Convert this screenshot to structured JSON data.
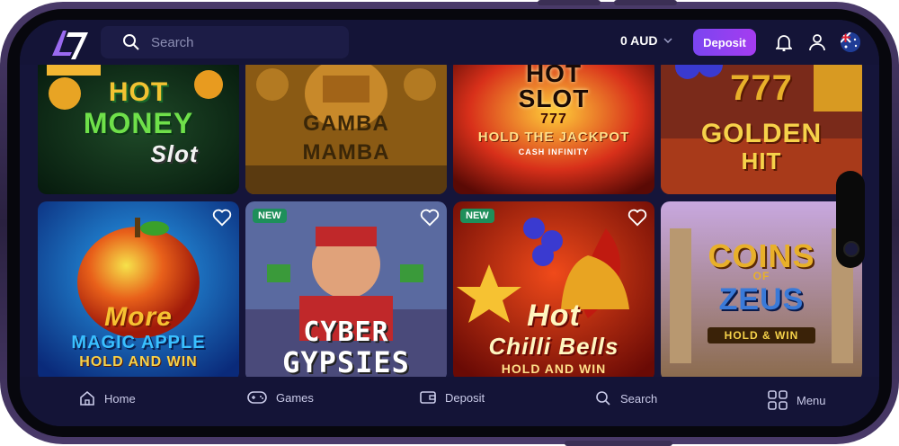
{
  "header": {
    "search_placeholder": "Search",
    "balance": "0 AUD",
    "deposit_label": "Deposit"
  },
  "games": [
    {
      "title_line1": "HOT",
      "title_line2": "MONEY",
      "title_line3": "Slot"
    },
    {
      "title_line1": "GAMBA",
      "title_line2": "MAMBA"
    },
    {
      "title_line1": "HOT",
      "title_line2": "SLOT",
      "title_line3": "777",
      "title_line4": "HOLD THE JACKPOT",
      "title_line5": "CASH INFINITY"
    },
    {
      "title_line1": "777",
      "title_line2": "GOLDEN",
      "title_line3": "HIT"
    },
    {
      "title_line1": "More",
      "title_line2": "MAGIC APPLE",
      "title_line3": "HOLD AND WIN"
    },
    {
      "badge": "NEW",
      "title_line1": "CYBER",
      "title_line2": "GYPSIES"
    },
    {
      "badge": "NEW",
      "title_line1": "Hot",
      "title_line2": "Chilli Bells",
      "title_line3": "HOLD AND WIN"
    },
    {
      "title_line1": "COINS",
      "title_line2": "OF",
      "title_line3": "ZEUS",
      "title_line4": "HOLD & WIN"
    }
  ],
  "bottom_nav": [
    {
      "label": "Home",
      "icon": "home-icon"
    },
    {
      "label": "Games",
      "icon": "gamepad-icon"
    },
    {
      "label": "Deposit",
      "icon": "wallet-icon"
    },
    {
      "label": "Search",
      "icon": "search-icon"
    },
    {
      "label": "Menu",
      "icon": "grid-icon"
    }
  ]
}
